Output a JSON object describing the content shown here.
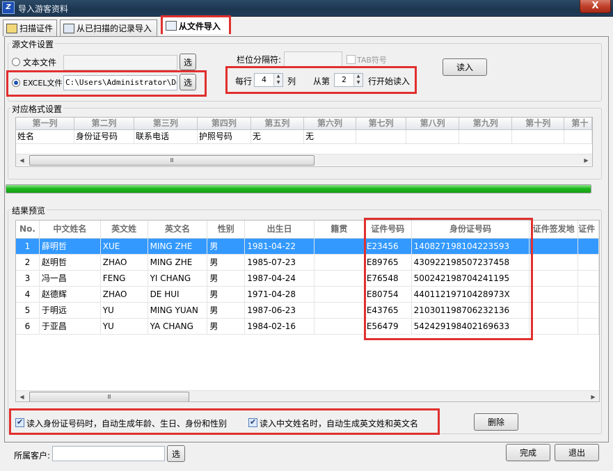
{
  "window": {
    "title": "导入游客资料",
    "app_icon": "ie-app-icon",
    "close": "X"
  },
  "tabs": [
    {
      "label": "扫描证件",
      "icon": "scanner-icon"
    },
    {
      "label": "从已扫描的记录导入",
      "icon": "records-icon"
    },
    {
      "label": "从文件导入",
      "icon": "file-import-icon",
      "active": true
    }
  ],
  "source": {
    "group_label": "源文件设置",
    "text_file_label": "文本文件",
    "text_file_value": "",
    "select_label": "选",
    "excel_label": "EXCEL文件",
    "excel_path": "C:\\Users\\Administrator\\Desl",
    "excel_selected": true,
    "delimiter_label": "栏位分隔符:",
    "delimiter_value": "",
    "tab_label": "TAB符号",
    "tab_checked": false,
    "per_row_label": "每行",
    "per_row_value": "4",
    "col_label": "列",
    "from_label": "从第",
    "from_value": "2",
    "start_row_label": "行开始读入",
    "read_button": "读入"
  },
  "mapping": {
    "group_label": "对应格式设置",
    "headers": [
      "第一列",
      "第二列",
      "第三列",
      "第四列",
      "第五列",
      "第六列",
      "第七列",
      "第八列",
      "第九列",
      "第十列",
      "第十"
    ],
    "values": [
      "姓名",
      "身份证号码",
      "联系电话",
      "护照号码",
      "无",
      "无",
      "",
      "",
      "",
      "",
      ""
    ],
    "thumb_mark": "Ⅲ"
  },
  "progress": {
    "value": 1.0,
    "color": "#1fb81f"
  },
  "results": {
    "group_label": "结果预览",
    "headers": [
      "No.",
      "中文姓名",
      "英文姓",
      "英文名",
      "性别",
      "出生日",
      "籍贯",
      "证件号码",
      "身份证号码",
      "证件签发地",
      "证件"
    ],
    "rows": [
      {
        "no": "1",
        "cn_name": "薛明哲",
        "en_surname": "XUE",
        "en_name": "MING ZHE",
        "gender": "男",
        "birth": "1981-04-22",
        "native": "",
        "doc_no": "E23456",
        "id_no": "140827198104223593",
        "issue": "",
        "extra": ""
      },
      {
        "no": "2",
        "cn_name": "赵明哲",
        "en_surname": "ZHAO",
        "en_name": "MING ZHE",
        "gender": "男",
        "birth": "1985-07-23",
        "native": "",
        "doc_no": "E89765",
        "id_no": "430922198507237458",
        "issue": "",
        "extra": ""
      },
      {
        "no": "3",
        "cn_name": "冯一昌",
        "en_surname": "FENG",
        "en_name": "YI CHANG",
        "gender": "男",
        "birth": "1987-04-24",
        "native": "",
        "doc_no": "E76548",
        "id_no": "500242198704241195",
        "issue": "",
        "extra": ""
      },
      {
        "no": "4",
        "cn_name": "赵德辉",
        "en_surname": "ZHAO",
        "en_name": "DE HUI",
        "gender": "男",
        "birth": "1971-04-28",
        "native": "",
        "doc_no": "E80754",
        "id_no": "44011219710428973X",
        "issue": "",
        "extra": ""
      },
      {
        "no": "5",
        "cn_name": "于明远",
        "en_surname": "YU",
        "en_name": "MING YUAN",
        "gender": "男",
        "birth": "1987-06-23",
        "native": "",
        "doc_no": "E43765",
        "id_no": "210301198706232136",
        "issue": "",
        "extra": ""
      },
      {
        "no": "6",
        "cn_name": "于亚昌",
        "en_surname": "YU",
        "en_name": "YA CHANG",
        "gender": "男",
        "birth": "1984-02-16",
        "native": "",
        "doc_no": "E56479",
        "id_no": "542429198402169633",
        "issue": "",
        "extra": ""
      }
    ]
  },
  "options": {
    "auto_age_label": "读入身份证号码时，自动生成年龄、生日、身份和性别",
    "auto_age_checked": true,
    "auto_en_label": "读入中文姓名时，自动生成英文姓和英文名",
    "auto_en_checked": true,
    "delete_button": "删除"
  },
  "footer": {
    "customer_label": "所属客户:",
    "customer_value": "",
    "select_label": "选",
    "done_button": "完成",
    "exit_button": "退出"
  },
  "colors": {
    "highlight": "#e0302e",
    "selection": "#3399ff"
  }
}
